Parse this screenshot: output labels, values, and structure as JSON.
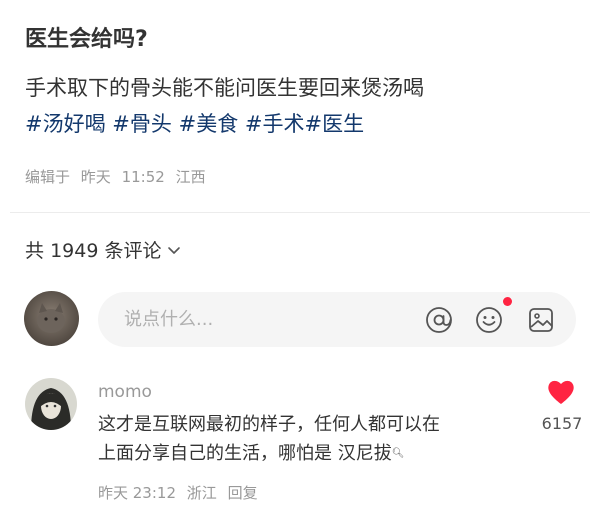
{
  "post": {
    "title": "医生会给吗?",
    "body_line1": "手术取下的骨头能不能问医生要回来煲汤喝",
    "hashtags": [
      "#汤好喝",
      "#骨头",
      "#美食",
      "#手术",
      "#医生"
    ],
    "edited_label": "编辑于",
    "edited_day": "昨天",
    "edited_time": "11:52",
    "location": "江西"
  },
  "comments_section": {
    "count_prefix": "共",
    "count": "1949",
    "count_suffix": "条评论",
    "input_placeholder": "说点什么...",
    "icons": {
      "at": "at-icon",
      "emoji": "emoji-icon",
      "image": "image-icon",
      "sort": "chevron-down-icon"
    },
    "notification_dot_color": "#ff2442"
  },
  "comment": {
    "username": "momo",
    "text_line1": "这才是互联网最初的样子，任何人都可以在",
    "text_line2_prefix": "上面分享自己的生活，哪怕是",
    "text_line2_link": "汉尼拔",
    "time": "昨天 23:12",
    "location": "浙江",
    "reply_label": "回复",
    "likes": "6157",
    "like_color": "#ff2442"
  },
  "colors": {
    "hashtag": "#13386c",
    "meta_text": "#999999",
    "input_background": "#f5f5f5"
  }
}
